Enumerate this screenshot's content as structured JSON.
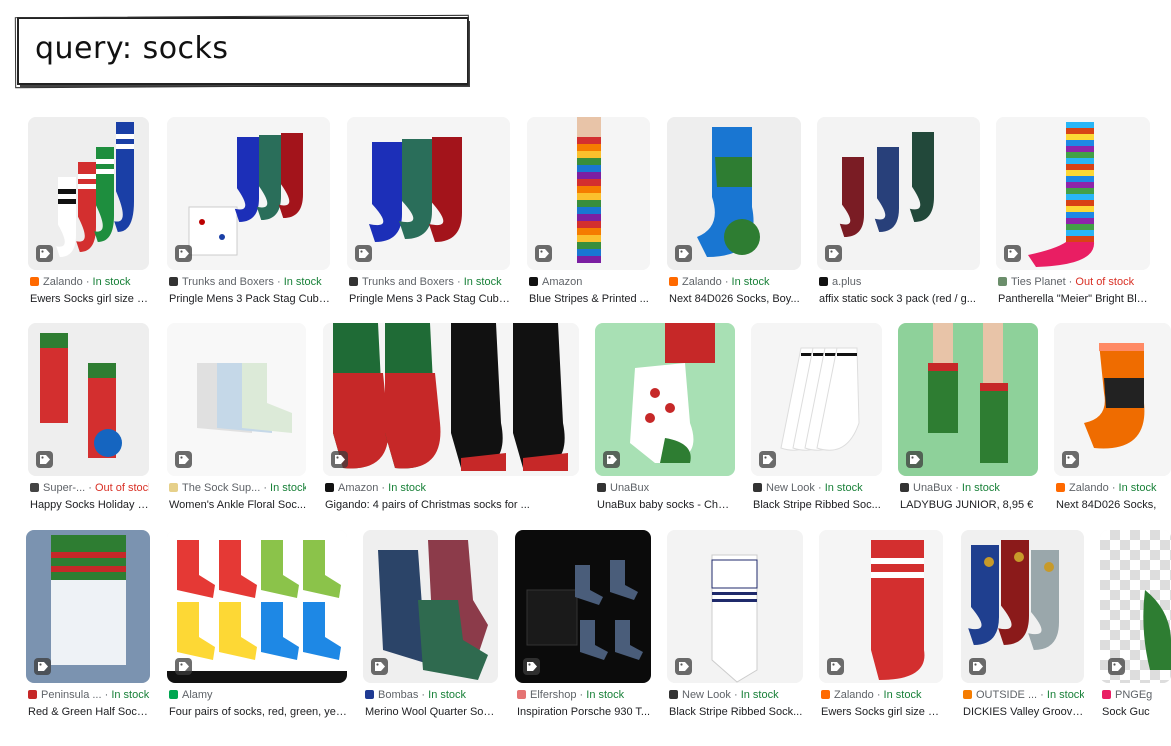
{
  "query": {
    "label": "query: socks"
  },
  "colors": {
    "in_stock": "#188038",
    "out_of_stock": "#d93025"
  },
  "results": [
    {
      "source": "Zalando",
      "dot": "·",
      "stock": "In stock",
      "title": "Ewers Socks girl size 3...",
      "icon": "zalando-icon"
    },
    {
      "source": "Trunks and Boxers",
      "dot": "·",
      "stock": "In stock",
      "title": "Pringle Mens 3 Pack Stag Cube...",
      "icon": "t-icon"
    },
    {
      "source": "Trunks and Boxers",
      "dot": "·",
      "stock": "In stock",
      "title": "Pringle Mens 3 Pack Stag Cube...",
      "icon": "t-icon"
    },
    {
      "source": "Amazon",
      "dot": "",
      "stock": "",
      "title": "Blue Stripes & Printed ...",
      "icon": "amazon-icon"
    },
    {
      "source": "Zalando",
      "dot": "·",
      "stock": "In stock",
      "title": "Next 84D026 Socks, Boy...",
      "icon": "zalando-icon"
    },
    {
      "source": "a.plus",
      "dot": "",
      "stock": "",
      "title": "affix static sock 3 pack (red / g...",
      "icon": "aplus-icon"
    },
    {
      "source": "Ties Planet",
      "dot": "·",
      "stock": "Out of stock",
      "title": "Pantherella \"Meier\" Bright Blu...",
      "icon": "ties-planet-icon"
    },
    {
      "source": "Super-...",
      "dot": "·",
      "stock": "Out of stock",
      "title": "Happy Socks Holiday L...",
      "icon": "super-icon"
    },
    {
      "source": "The Sock Sup...",
      "dot": "·",
      "stock": "In stock",
      "title": "Women's Ankle Floral Soc...",
      "icon": "sock-supply-icon"
    },
    {
      "source": "Amazon",
      "dot": "·",
      "stock": "In stock",
      "title": "Gigando: 4 pairs of Christmas socks for ...",
      "icon": "amazon-icon"
    },
    {
      "source": "UnaBux",
      "dot": "",
      "stock": "",
      "title": "UnaBux baby socks - Cher...",
      "icon": "unabux-icon"
    },
    {
      "source": "New Look",
      "dot": "·",
      "stock": "In stock",
      "title": "Black Stripe Ribbed Soc...",
      "icon": "new-look-icon"
    },
    {
      "source": "UnaBux",
      "dot": "·",
      "stock": "In stock",
      "title": "LADYBUG JUNIOR, 8,95 €",
      "icon": "unabux-icon"
    },
    {
      "source": "Zalando",
      "dot": "·",
      "stock": "In stock",
      "title": "Next 84D026 Socks,",
      "icon": "zalando-icon"
    },
    {
      "source": "Peninsula ...",
      "dot": "·",
      "stock": "In stock",
      "title": "Red & Green Half Sock...",
      "icon": "peninsula-icon"
    },
    {
      "source": "Alamy",
      "dot": "",
      "stock": "",
      "title": "Four pairs of socks, red, green, yell...",
      "icon": "alamy-icon"
    },
    {
      "source": "Bombas",
      "dot": "·",
      "stock": "In stock",
      "title": "Merino Wool Quarter Soc...",
      "icon": "bombas-icon"
    },
    {
      "source": "Elfershop",
      "dot": "·",
      "stock": "In stock",
      "title": "Inspiration Porsche 930 T...",
      "icon": "elfershop-icon"
    },
    {
      "source": "New Look",
      "dot": "·",
      "stock": "In stock",
      "title": "Black Stripe Ribbed Sock...",
      "icon": "new-look-icon"
    },
    {
      "source": "Zalando",
      "dot": "·",
      "stock": "In stock",
      "title": "Ewers Socks girl size 3...",
      "icon": "zalando-icon"
    },
    {
      "source": "OUTSIDE ...",
      "dot": "·",
      "stock": "In stock",
      "title": "DICKIES Valley Groove ...",
      "icon": "outside-icon"
    },
    {
      "source": "PNGEg",
      "dot": "",
      "stock": "",
      "title": "Sock Guc",
      "icon": "pngegg-icon"
    }
  ]
}
